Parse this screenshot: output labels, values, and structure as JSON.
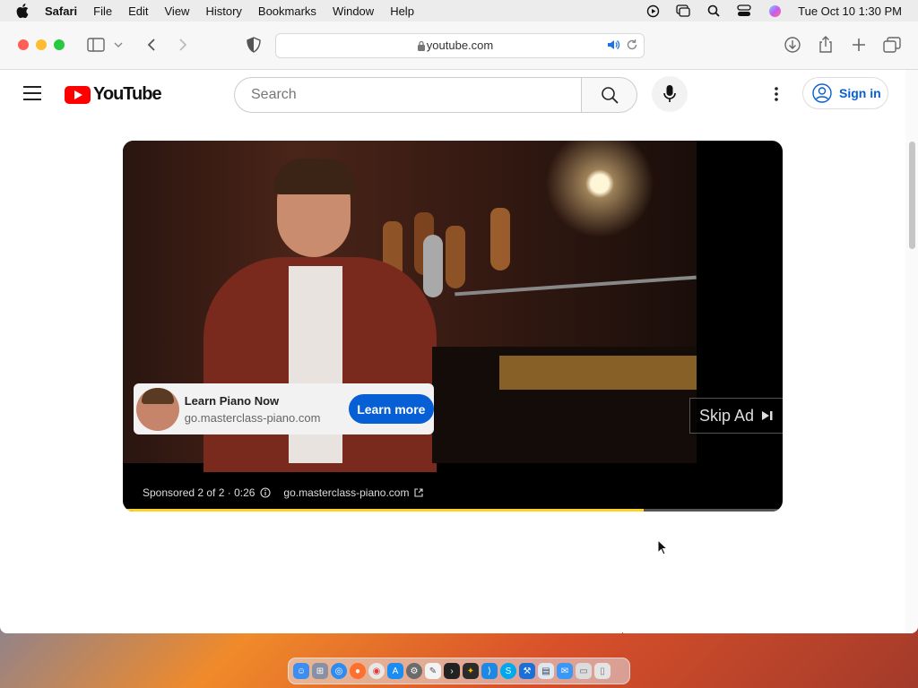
{
  "menubar": {
    "app_name": "Safari",
    "menus": [
      "File",
      "Edit",
      "View",
      "History",
      "Bookmarks",
      "Window",
      "Help"
    ],
    "clock": "Tue Oct 10  1:30 PM",
    "icons": [
      "play-circle-icon",
      "screen-mirroring-icon",
      "spotlight-search-icon",
      "control-center-icon",
      "siri-icon"
    ]
  },
  "browser": {
    "url": "youtube.com",
    "icons": [
      "sidebar-icon",
      "chevron-down-icon",
      "back-icon",
      "forward-icon",
      "privacy-shield-icon",
      "download-icon",
      "share-icon",
      "new-tab-icon",
      "tab-overview-icon"
    ]
  },
  "youtube": {
    "logo_text": "YouTube",
    "search_placeholder": "Search",
    "sign_in": "Sign in"
  },
  "player": {
    "ad": {
      "title": "Learn Piano Now",
      "domain": "go.masterclass-piano.com",
      "cta": "Learn more"
    },
    "skip_label": "Skip Ad",
    "sponsored_text": "Sponsored 2 of 2 · 0:26",
    "sponsored_domain": "go.masterclass-piano.com",
    "progress_fraction": 0.79,
    "colors": {
      "progress": "#fcd12a",
      "cta": "#065fd4"
    }
  },
  "dock": {
    "apps": [
      "finder-icon",
      "launchpad-icon",
      "safari-icon",
      "firefox-icon",
      "chrome-icon",
      "app-store-icon",
      "system-settings-icon",
      "textedit-icon",
      "terminal-icon",
      "instruments-icon",
      "vscode-icon",
      "skype-icon",
      "xcode-icon",
      "preview-icon",
      "mail-icon",
      "downloads-folder-icon",
      "trash-icon"
    ]
  }
}
